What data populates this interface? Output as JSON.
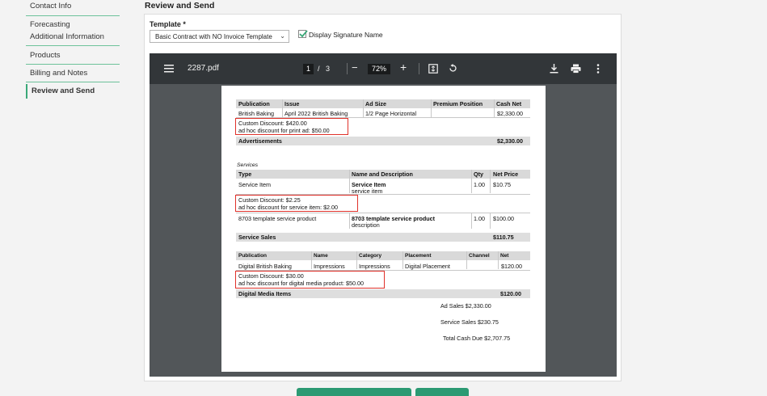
{
  "sidebar": {
    "items": [
      {
        "label": "Contact Info"
      },
      {
        "label": "Forecasting"
      },
      {
        "label": "Additional Information"
      },
      {
        "label": "Products"
      },
      {
        "label": "Billing and Notes"
      },
      {
        "label": "Review and Send"
      }
    ]
  },
  "page": {
    "title": "Review and Send"
  },
  "template": {
    "label": "Template *",
    "selected": "Basic Contract with NO Invoice Template",
    "display_signature": "Display Signature Name"
  },
  "viewer": {
    "filename": "2287.pdf",
    "current_page": "1",
    "page_sep": "/",
    "total_pages": "3",
    "zoom": "72%",
    "zoom_out": "−",
    "zoom_in": "+"
  },
  "doc": {
    "ads": {
      "headers": [
        "Publication",
        "Issue",
        "Ad Size",
        "Premium Position",
        "Cash Net"
      ],
      "row": [
        "British Baking",
        "April 2022 British Baking",
        "1/2 Page Horizontal",
        "",
        "$2,330.00"
      ],
      "discount1": "Custom Discount: $420.00",
      "discount2": "ad hoc discount for print ad: $50.00",
      "total_label": "Advertisements",
      "total": "$2,330.00"
    },
    "services": {
      "section": "Services",
      "headers": [
        "Type",
        "Name and Description",
        "Qty",
        "Net Price"
      ],
      "row1": [
        "Service Item",
        "Service Item",
        "service item",
        "1.00",
        "$10.75"
      ],
      "discount1": "Custom Discount: $2.25",
      "discount2": "ad hoc discount for service item: $2.00",
      "row2": [
        "8703 template service product",
        "8703 template service product",
        "description",
        "1.00",
        "$100.00"
      ],
      "total_label": "Service Sales",
      "total": "$110.75"
    },
    "digital": {
      "headers": [
        "Publication",
        "Name",
        "Category",
        "Placement",
        "Channel",
        "Net"
      ],
      "row": [
        "Digital British Baking",
        "Impressions",
        "Impressions",
        "Digital Placement",
        "",
        "$120.00"
      ],
      "discount1": "Custom Discount: $30.00",
      "discount2": "ad hoc discount for digital media product: $50.00",
      "total_label": "Digital Media Items",
      "total": "$120.00"
    },
    "summary": {
      "ad_sales": "Ad Sales $2,330.00",
      "service_sales": "Service Sales $230.75",
      "total_due": "Total Cash Due $2,707.75"
    }
  },
  "colors": {
    "accent": "#3aa878",
    "toolbar": "#323639",
    "viewer_bg": "#525659",
    "highlight": "#e0312a"
  }
}
